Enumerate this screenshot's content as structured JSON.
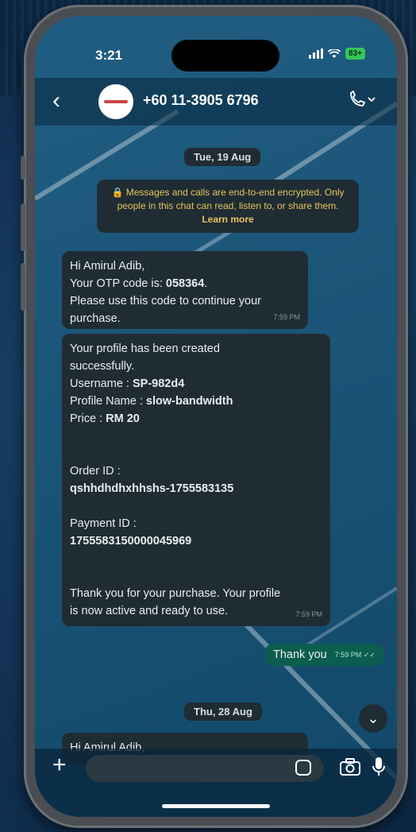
{
  "status": {
    "time": "3:21",
    "battery": "83+"
  },
  "header": {
    "contact": "+60 11-3905 6796"
  },
  "dates": {
    "first": "Tue, 19 Aug",
    "second": "Thu, 28 Aug"
  },
  "encryption_notice": {
    "text": "🔒 Messages and calls are end-to-end encrypted. Only people in this chat can read, listen to, or share them.",
    "link": "Learn more"
  },
  "messages": {
    "otp": {
      "line1": "Hi Amirul Adib,",
      "line2_prefix": "Your OTP code is: ",
      "line2_code": "058364",
      "line2_suffix": ".",
      "line3": "Please use this code to continue your",
      "line4": "purchase.",
      "time": "7:59 PM"
    },
    "profile": {
      "line1": "Your profile has been created",
      "line2": "successfully.",
      "username_label": "Username : ",
      "username_value": "SP-982d4",
      "profile_label": "Profile Name : ",
      "profile_value": "slow-bandwidth",
      "price_label": "Price : ",
      "price_value": "RM 20",
      "order_label": "Order ID :",
      "order_value": "qshhdhdhxhhshs-1755583135",
      "payment_label": "Payment ID :",
      "payment_value": "1755583150000045969",
      "thanks1": "Thank you for your purchase. Your profile",
      "thanks2": "is now active and ready to use.",
      "time": "7:59 PM"
    },
    "outgoing": {
      "text": "Thank you",
      "time": "7:59 PM"
    },
    "latest": {
      "line1": "Hi Amirul Adib,"
    }
  },
  "composer": {
    "placeholder": ""
  },
  "colors": {
    "chat_bg": "#15557c",
    "incoming_bubble": "#202c33",
    "outgoing_bubble": "#0b5e4f",
    "notice_text": "#e7c45a"
  }
}
